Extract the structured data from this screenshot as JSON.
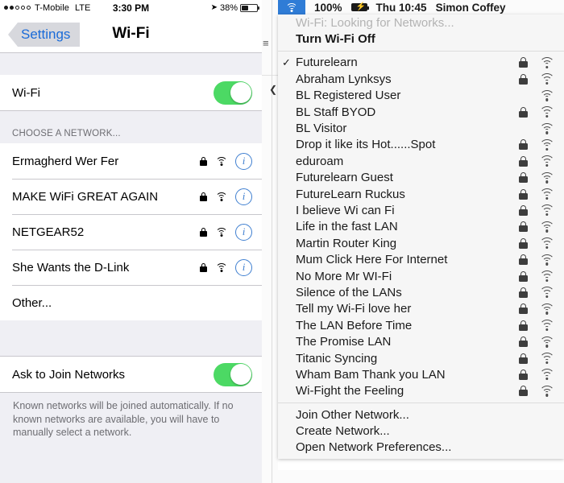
{
  "ios": {
    "status_bar": {
      "signal_filled": 2,
      "signal_total": 5,
      "carrier": "T-Mobile",
      "network_type": "LTE",
      "time": "3:30 PM",
      "location_icon": "location-arrow-icon",
      "battery_percent": "38%",
      "battery_level": 38
    },
    "nav": {
      "back_label": "Settings",
      "title": "Wi-Fi"
    },
    "wifi_row": {
      "label": "Wi-Fi",
      "toggle_on": true
    },
    "choose_header": "CHOOSE A NETWORK...",
    "networks": [
      {
        "name": "Ermagherd Wer Fer",
        "locked": true
      },
      {
        "name": "MAKE WiFi GREAT AGAIN",
        "locked": true
      },
      {
        "name": "NETGEAR52",
        "locked": true
      },
      {
        "name": "She Wants the D-Link",
        "locked": true
      }
    ],
    "other_label": "Other...",
    "ask_row": {
      "label": "Ask to Join Networks",
      "toggle_on": true
    },
    "footnote": "Known networks will be joined automatically. If no known networks are available, you will have to manually select a network."
  },
  "mac": {
    "menu_bar": {
      "wifi_icon": "wifi-icon",
      "battery_percent": "100%",
      "battery_icon": "battery-charging-icon",
      "date_time": "Thu 10:45",
      "user_name": "Simon Coffey"
    },
    "menu": {
      "status_label": "Wi-Fi: Looking for Networks...",
      "toggle_label": "Turn Wi-Fi Off",
      "networks": [
        {
          "name": "Futurelearn",
          "locked": true,
          "connected": true
        },
        {
          "name": "Abraham Lynksys",
          "locked": true,
          "connected": false
        },
        {
          "name": "BL Registered User",
          "locked": false,
          "connected": false
        },
        {
          "name": "BL Staff BYOD",
          "locked": true,
          "connected": false
        },
        {
          "name": "BL Visitor",
          "locked": false,
          "connected": false
        },
        {
          "name": "Drop it like its Hot......Spot",
          "locked": true,
          "connected": false
        },
        {
          "name": "eduroam",
          "locked": true,
          "connected": false
        },
        {
          "name": "Futurelearn Guest",
          "locked": true,
          "connected": false
        },
        {
          "name": "FutureLearn Ruckus",
          "locked": true,
          "connected": false
        },
        {
          "name": "I believe Wi can Fi",
          "locked": true,
          "connected": false
        },
        {
          "name": "Life in the fast LAN",
          "locked": true,
          "connected": false
        },
        {
          "name": "Martin Router King",
          "locked": true,
          "connected": false
        },
        {
          "name": "Mum Click Here For Internet",
          "locked": true,
          "connected": false
        },
        {
          "name": "No More Mr WI-Fi",
          "locked": true,
          "connected": false
        },
        {
          "name": "Silence of the LANs",
          "locked": true,
          "connected": false
        },
        {
          "name": "Tell my Wi-Fi love her",
          "locked": true,
          "connected": false
        },
        {
          "name": "The LAN Before Time",
          "locked": true,
          "connected": false
        },
        {
          "name": "The Promise LAN",
          "locked": true,
          "connected": false
        },
        {
          "name": "Titanic Syncing",
          "locked": true,
          "connected": false
        },
        {
          "name": "Wham Bam Thank you LAN",
          "locked": true,
          "connected": false
        },
        {
          "name": "Wi-Fight the Feeling",
          "locked": true,
          "connected": false
        }
      ],
      "actions": [
        "Join Other Network...",
        "Create Network...",
        "Open Network Preferences..."
      ]
    }
  },
  "colors": {
    "ios_toggle_green": "#4cd964",
    "ios_tint_blue": "#1a6bd8",
    "ios_group_bg": "#efeff4",
    "mac_menu_bg": "#f6f6f6",
    "mac_highlight_blue": "#2f7cd6"
  }
}
